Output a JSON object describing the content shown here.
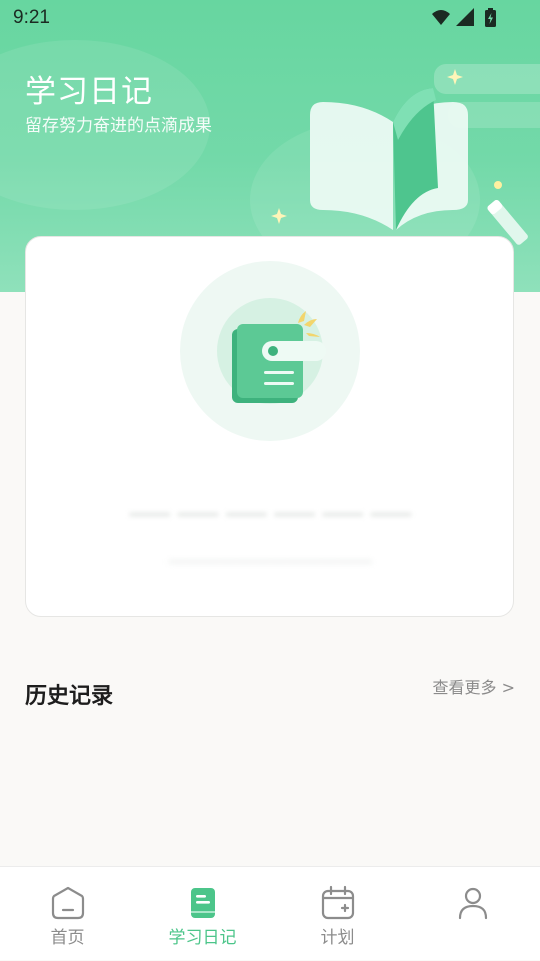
{
  "status_bar": {
    "time": "9:21",
    "icons": [
      "wifi-icon",
      "cellular-signal-icon",
      "battery-charging-icon"
    ]
  },
  "header": {
    "title": "学习日记",
    "subtitle": "留存努力奋进的点滴成果"
  },
  "empty_card": {
    "illustration": "diary-book-icon"
  },
  "history": {
    "title": "历史记录",
    "more_label": "查看更多 >"
  },
  "tabbar": {
    "tabs": [
      {
        "label": "首页",
        "icon": "home-icon",
        "active": false
      },
      {
        "label": "学习日记",
        "icon": "diary-icon",
        "active": true
      },
      {
        "label": "计划",
        "icon": "calendar-plus-icon",
        "active": false
      },
      {
        "label": "",
        "icon": "profile-icon",
        "active": false
      }
    ]
  },
  "colors": {
    "brand_green": "#67d6a0",
    "active_tab": "#4cc58a",
    "inactive_tab": "#8c8c8c",
    "page_background": "#faf9f7"
  }
}
